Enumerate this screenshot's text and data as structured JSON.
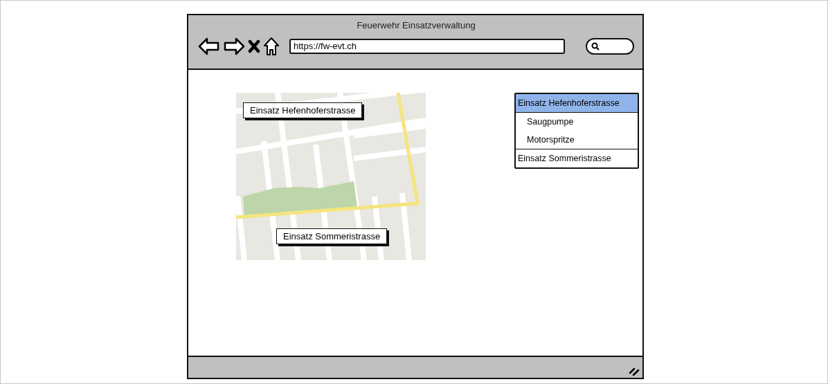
{
  "window": {
    "title": "Feuerwehr Einsatzverwaltung"
  },
  "address_bar": {
    "value": "https://fw-evt.ch"
  },
  "map": {
    "markers": [
      {
        "label": "Einsatz Hefenhoferstrasse"
      },
      {
        "label": "Einsatz Sommeristrasse"
      }
    ]
  },
  "tree": [
    {
      "label": "Einsatz Hefenhoferstrasse",
      "selected": true,
      "expanded": true,
      "children": [
        {
          "label": "Saugpumpe",
          "selected": false
        },
        {
          "label": "Motorspritze",
          "selected": false
        }
      ]
    },
    {
      "label": "Einsatz Sommeristrasse",
      "selected": false,
      "expanded": false
    }
  ]
}
